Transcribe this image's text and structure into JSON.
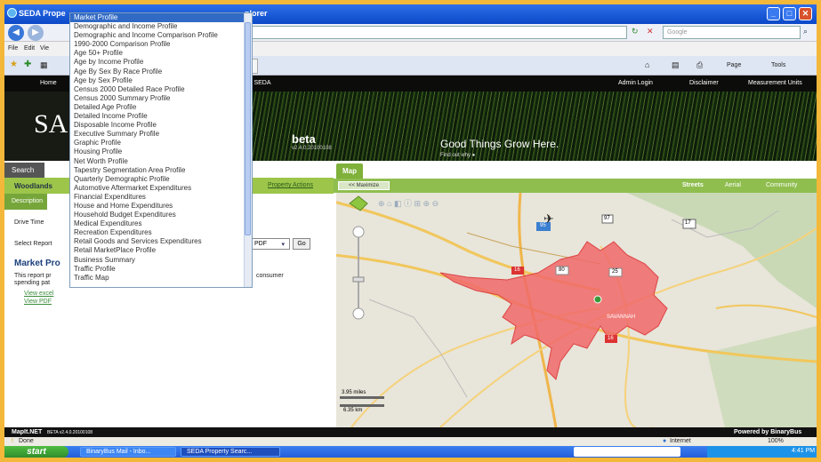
{
  "window": {
    "title": "SEDA Prope",
    "title_tail": "plorer",
    "buttons": [
      "_",
      "□",
      "✕"
    ]
  },
  "browser": {
    "search_placeholder": "Google",
    "menu": [
      "File",
      "Edit",
      "Vie"
    ],
    "page_label": "Page",
    "tools_label": "Tools"
  },
  "site": {
    "nav": [
      "Home",
      "y SEDA",
      "Admin Login",
      "Disclaimer",
      "Measurement Units"
    ],
    "logo": "SA",
    "beta": "beta",
    "version": "v2.4.0.20100108",
    "tagline": "Good Things Grow Here.",
    "find_out": "Find out why ●"
  },
  "left_panel": {
    "search_tab": "Search",
    "location": "Woodlands",
    "property_actions": "Property Actions",
    "description_tab": "Description",
    "drive_time_label": "Drive Time",
    "select_report_label": "Select Report",
    "format_value": "PDF",
    "go_button": "Go",
    "market_profile_heading": "Market Pro",
    "report_text_start": "This report pr",
    "report_text_line2": "spending pat",
    "consumer_tail": "consumer",
    "view_excel": "View excel",
    "view_pdf": "View PDF"
  },
  "map_panel": {
    "tab": "Map",
    "maximize": "<< Maximize",
    "types": [
      "Streets",
      "Aerial",
      "Community"
    ],
    "scale_miles": "3.95 miles",
    "scale_km": "6.35 km",
    "route_labels": [
      "97",
      "95",
      "17",
      "16",
      "80",
      "16",
      "25"
    ],
    "city_label": "SAVANNAH"
  },
  "report_dropdown": {
    "options": [
      "Market Profile",
      "Demographic and Income Profile",
      "Demographic and Income Comparison Profile",
      "1990-2000 Comparison Profile",
      "Age 50+ Profile",
      "Age by Income Profile",
      "Age By Sex By Race Profile",
      "Age by Sex Profile",
      "Census 2000 Detailed Race Profile",
      "Census 2000 Summary Profile",
      "Detailed Age Profile",
      "Detailed Income Profile",
      "Disposable Income Profile",
      "Executive Summary Profile",
      "Graphic Profile",
      "Housing Profile",
      "Net Worth Profile",
      "Tapestry Segmentation Area Profile",
      "Quarterly Demographic Profile",
      "Automotive Aftermarket Expenditures",
      "Financial Expenditures",
      "House and Home Expenditures",
      "Household Budget Expenditures",
      "Medical Expenditures",
      "Recreation Expenditures",
      "Retail Goods and Services Expenditures",
      "Retail MarketPlace Profile",
      "Business Summary",
      "Traffic Profile",
      "Traffic Map"
    ],
    "selected": "Market Profile"
  },
  "footer": {
    "mapit": "MapIt.NET",
    "mapit_version": "BETA v2.4.0.20100108",
    "powered_by": "Powered by BinaryBus"
  },
  "status": {
    "done": "Done",
    "zone": "Internet",
    "zoom": "100%"
  },
  "taskbar": {
    "start": "start",
    "tasks": [
      "BinaryBus Mail - Inbo...",
      "SEDA Property Searc..."
    ],
    "clock": "4:41 PM"
  }
}
